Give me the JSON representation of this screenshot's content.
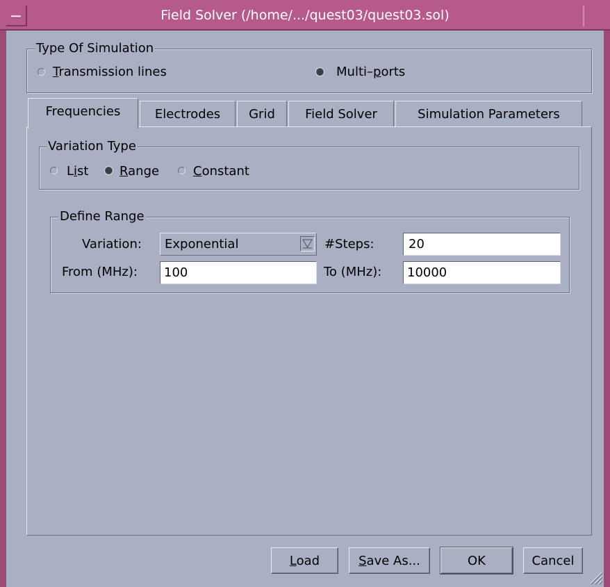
{
  "window": {
    "title": "Field Solver (/home/.../quest03/quest03.sol)",
    "colors": {
      "titlebar": "#b55a8b",
      "background": "#aab0c4",
      "frame": "#9e4a77"
    }
  },
  "simulation_type": {
    "group_title": "Type Of Simulation",
    "options": [
      {
        "prefix": "",
        "mnemonic": "T",
        "rest": "ransmission lines",
        "selected": false
      },
      {
        "prefix": "Multi–",
        "mnemonic": "p",
        "rest": "orts",
        "selected": true
      }
    ]
  },
  "tabs": [
    {
      "label": "Frequencies",
      "active": true
    },
    {
      "label": "Electrodes",
      "active": false
    },
    {
      "label": "Grid",
      "active": false
    },
    {
      "label": "Field Solver",
      "active": false
    },
    {
      "label": "Simulation Parameters",
      "active": false
    }
  ],
  "variation_type": {
    "group_title": "Variation Type",
    "options": [
      {
        "prefix": "L",
        "mnemonic": "i",
        "rest": "st",
        "selected": false
      },
      {
        "prefix": "",
        "mnemonic": "R",
        "rest": "ange",
        "selected": true
      },
      {
        "prefix": "",
        "mnemonic": "C",
        "rest": "onstant",
        "selected": false
      }
    ]
  },
  "define_range": {
    "group_title": "Define Range",
    "variation_label": "Variation:",
    "variation_value": "Exponential",
    "steps_label": "#Steps:",
    "steps_value": "20",
    "from_label": "From (MHz):",
    "from_value": "100",
    "to_label": "To (MHz):",
    "to_value": "10000"
  },
  "buttons": {
    "load": {
      "mnemonic": "L",
      "rest": "oad"
    },
    "save_as": {
      "mnemonic": "S",
      "rest": "ave As..."
    },
    "ok": "OK",
    "cancel": "Cancel"
  }
}
